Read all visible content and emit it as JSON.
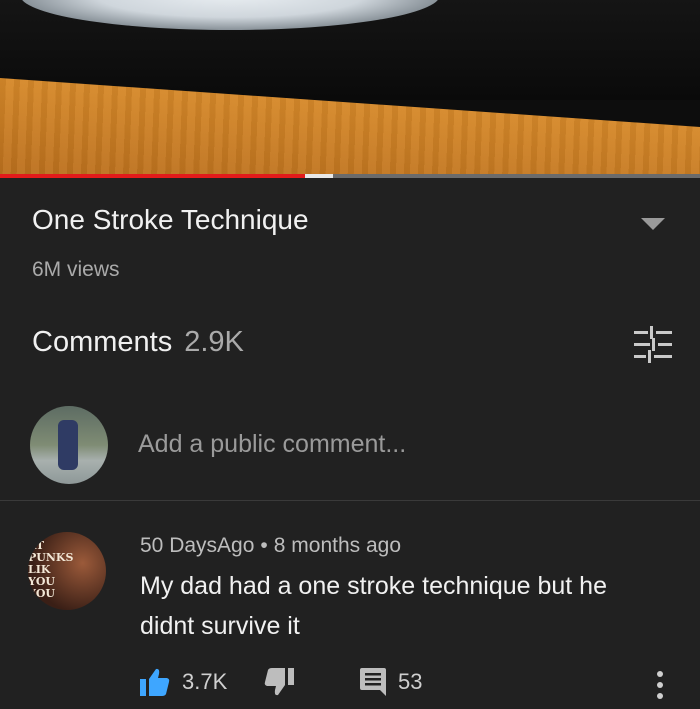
{
  "video": {
    "progress_fraction": 0.435,
    "buffered_fraction": 0.04,
    "colors": {
      "progress": "#e21b1b",
      "track": "#6b6b6b",
      "buffer": "#e8e8e8"
    }
  },
  "info": {
    "title": "One Stroke Technique",
    "views": "6M views",
    "expand_icon": "chevron-down-icon"
  },
  "comments": {
    "label": "Comments",
    "count": "2.9K",
    "sort_icon": "filter-sliders-icon",
    "add_placeholder": "Add a public comment...",
    "items": [
      {
        "author": "50 DaysAgo",
        "time": "8 months ago",
        "text": "My dad had a one stroke technique but he didnt survive it",
        "likes": "3.7K",
        "replies": "53",
        "avatar_lettering": "AT PUNKS LIK YOU YOU"
      }
    ]
  },
  "colors": {
    "background": "#212121",
    "like_accent": "#3ea6ff",
    "secondary_text": "#aaaaaa"
  }
}
